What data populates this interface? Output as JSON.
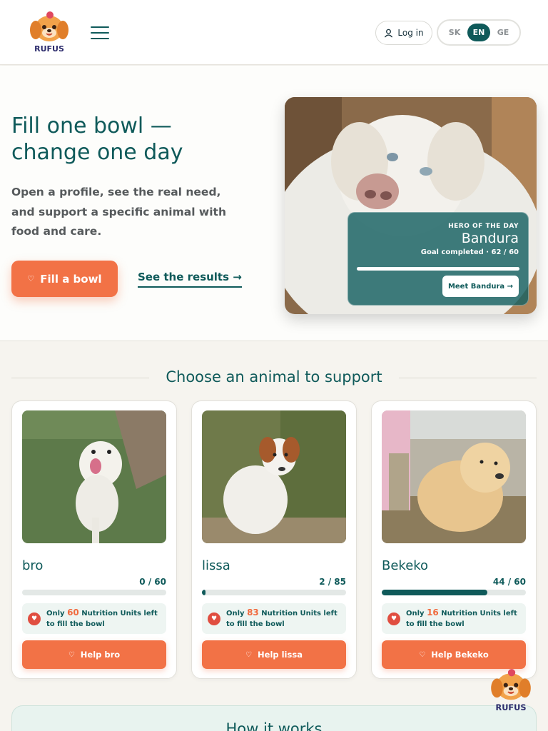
{
  "header": {
    "logo_text": "RUFUS",
    "login_label": "Log in",
    "languages": [
      {
        "code": "SK",
        "active": false
      },
      {
        "code": "EN",
        "active": true
      },
      {
        "code": "GE",
        "active": false
      }
    ]
  },
  "hero": {
    "title_line1": "Fill one bowl —",
    "title_line2": "change one day",
    "description": "Open a profile, see the real need, and support a specific animal with food and care.",
    "fill_button": "Fill a bowl",
    "results_link": "See the results →",
    "feature": {
      "kicker": "HERO OF THE DAY",
      "name": "Bandura",
      "goal_text": "Goal completed · 62 / 60",
      "progress": 1.0,
      "button": "Meet Bandura →"
    }
  },
  "section": {
    "title": "Choose an animal to support"
  },
  "animals": [
    {
      "name": "bro",
      "count": "0 / 60",
      "progress": 0.0,
      "note_prefix": "Only ",
      "units_left": "60",
      "note_suffix": " Nutrition Units left to fill the bowl",
      "button": "Help bro"
    },
    {
      "name": "lissa",
      "count": "2 / 85",
      "progress": 0.024,
      "note_prefix": "Only ",
      "units_left": "83",
      "note_suffix": " Nutrition Units left to fill the bowl",
      "button": "Help lissa"
    },
    {
      "name": "Bekeko",
      "count": "44 / 60",
      "progress": 0.733,
      "note_prefix": "Only ",
      "units_left": "16",
      "note_suffix": " Nutrition Units left to fill the bowl",
      "button": "Help Bekeko"
    }
  ],
  "how": {
    "title": "How it works"
  },
  "colors": {
    "brand_teal": "#0f5a5a",
    "accent_orange": "#f27246",
    "heart_red": "#e04e40"
  }
}
